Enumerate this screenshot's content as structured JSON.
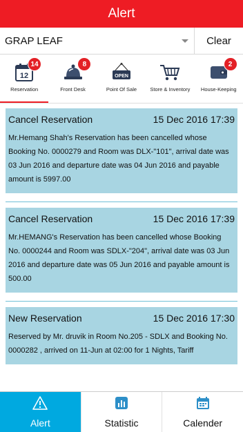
{
  "header": {
    "title": "Alert"
  },
  "filter": {
    "selected": "GRAP LEAF",
    "clear_label": "Clear"
  },
  "modules": [
    {
      "label": "Reservation",
      "badge": "14",
      "icon": "calendar-icon"
    },
    {
      "label": "Front Desk",
      "badge": "8",
      "icon": "bell-icon"
    },
    {
      "label": "Point Of Sale",
      "badge": "",
      "icon": "open-sign-icon"
    },
    {
      "label": "Store & Inventory",
      "badge": "",
      "icon": "cart-icon"
    },
    {
      "label": "House-Keeping",
      "badge": "2",
      "icon": "wallet-icon"
    }
  ],
  "alerts": [
    {
      "title": "Cancel Reservation",
      "date": "15 Dec 2016 17:39",
      "body": "Mr.Hemang Shah's Reservation has been cancelled whose Booking No. 0000279 and Room was DLX-\"101\", arrival date was 03 Jun 2016 and departure date was 04 Jun 2016 and payable amount is 5997.00"
    },
    {
      "title": "Cancel Reservation",
      "date": "15 Dec 2016 17:39",
      "body": "Mr.HEMANG's Reservation has been cancelled whose Booking No. 0000244 and Room was SDLX-\"204\", arrival date was 03 Jun 2016 and departure date was 05 Jun 2016 and payable amount is 500.00"
    },
    {
      "title": "New Reservation",
      "date": "15 Dec 2016 17:30",
      "body": "Reserved by Mr. druvik in Room No.205 - SDLX and Booking No. 0000282 , arrived on 11-Jun at 02:00 for 1 Nights, Tariff"
    }
  ],
  "tabs": [
    {
      "label": "Alert",
      "icon": "warning-icon"
    },
    {
      "label": "Statistic",
      "icon": "chart-icon"
    },
    {
      "label": "Calender",
      "icon": "calendar-icon"
    }
  ],
  "colors": {
    "brand": "#ee1c24",
    "card": "#a8d5e2",
    "active_tab": "#00a9e0"
  }
}
